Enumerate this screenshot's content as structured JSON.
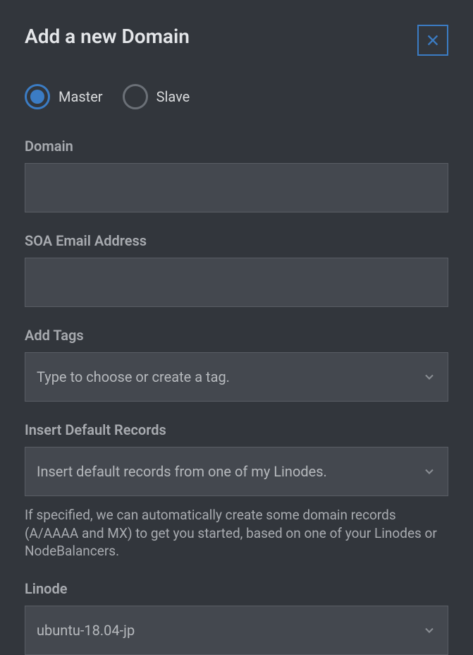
{
  "header": {
    "title": "Add a new Domain"
  },
  "radio": {
    "master": "Master",
    "slave": "Slave",
    "selected": "master"
  },
  "fields": {
    "domain": {
      "label": "Domain",
      "value": ""
    },
    "soa_email": {
      "label": "SOA Email Address",
      "value": ""
    },
    "tags": {
      "label": "Add Tags",
      "placeholder": "Type to choose or create a tag."
    },
    "default_records": {
      "label": "Insert Default Records",
      "value": "Insert default records from one of my Linodes.",
      "help": "If specified, we can automatically create some domain records (A/AAAA and MX) to get you started, based on one of your Linodes or NodeBalancers."
    },
    "linode": {
      "label": "Linode",
      "value": "ubuntu-18.04-jp"
    }
  }
}
